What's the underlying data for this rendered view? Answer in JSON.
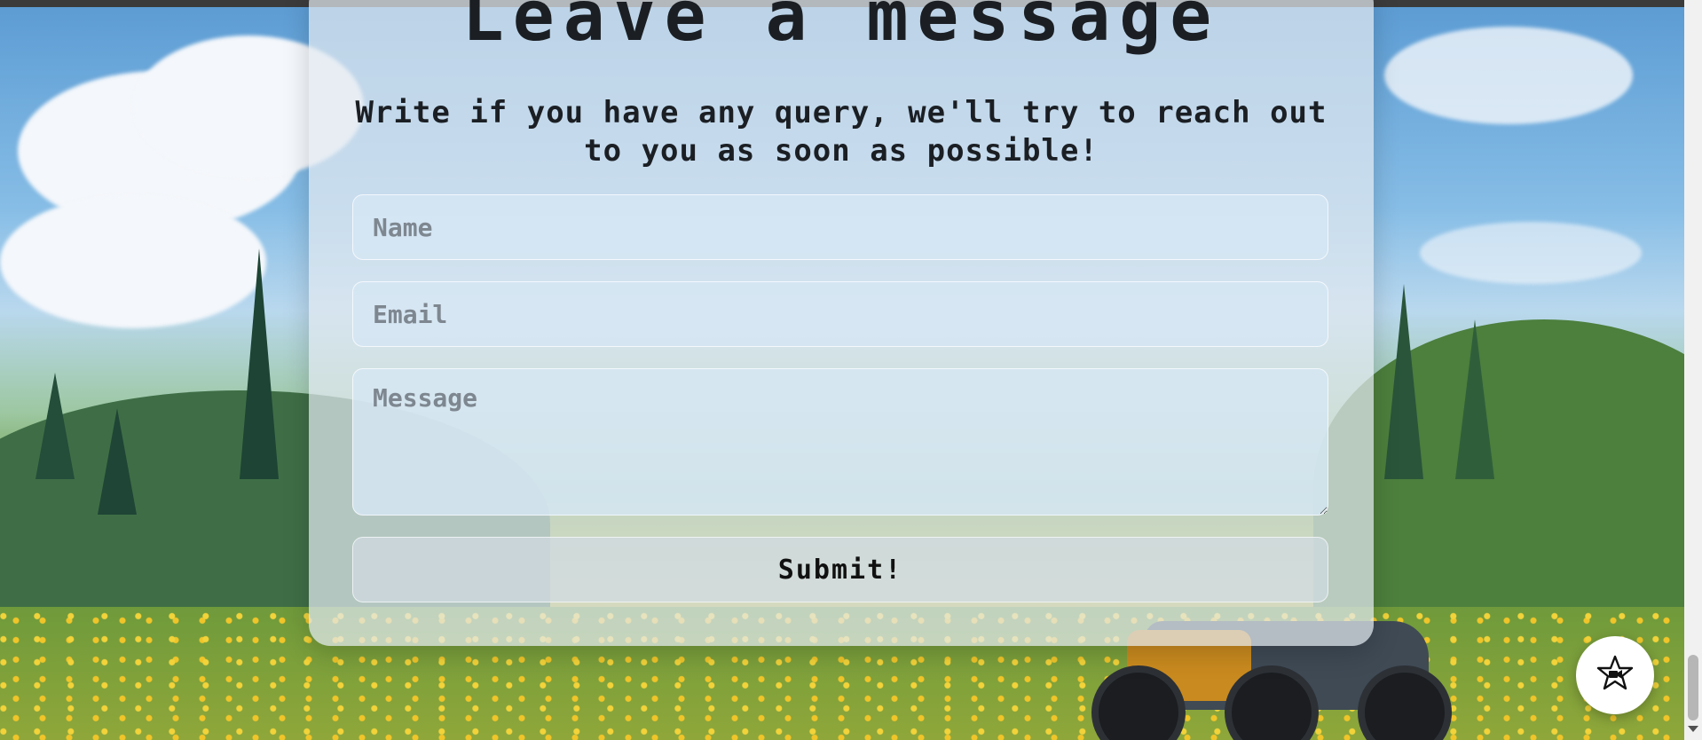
{
  "form": {
    "title": "Leave a message",
    "subtitle": "Write if you have any query, we'll try to reach out to you as soon as possible!",
    "name_placeholder": "Name",
    "email_placeholder": "Email",
    "message_placeholder": "Message",
    "submit_label": "Submit!"
  },
  "floating_button": {
    "icon": "star-video-icon"
  },
  "colors": {
    "card_bg": "#e2e9f0",
    "text": "#1b1f24",
    "placeholder": "#7e8790"
  }
}
